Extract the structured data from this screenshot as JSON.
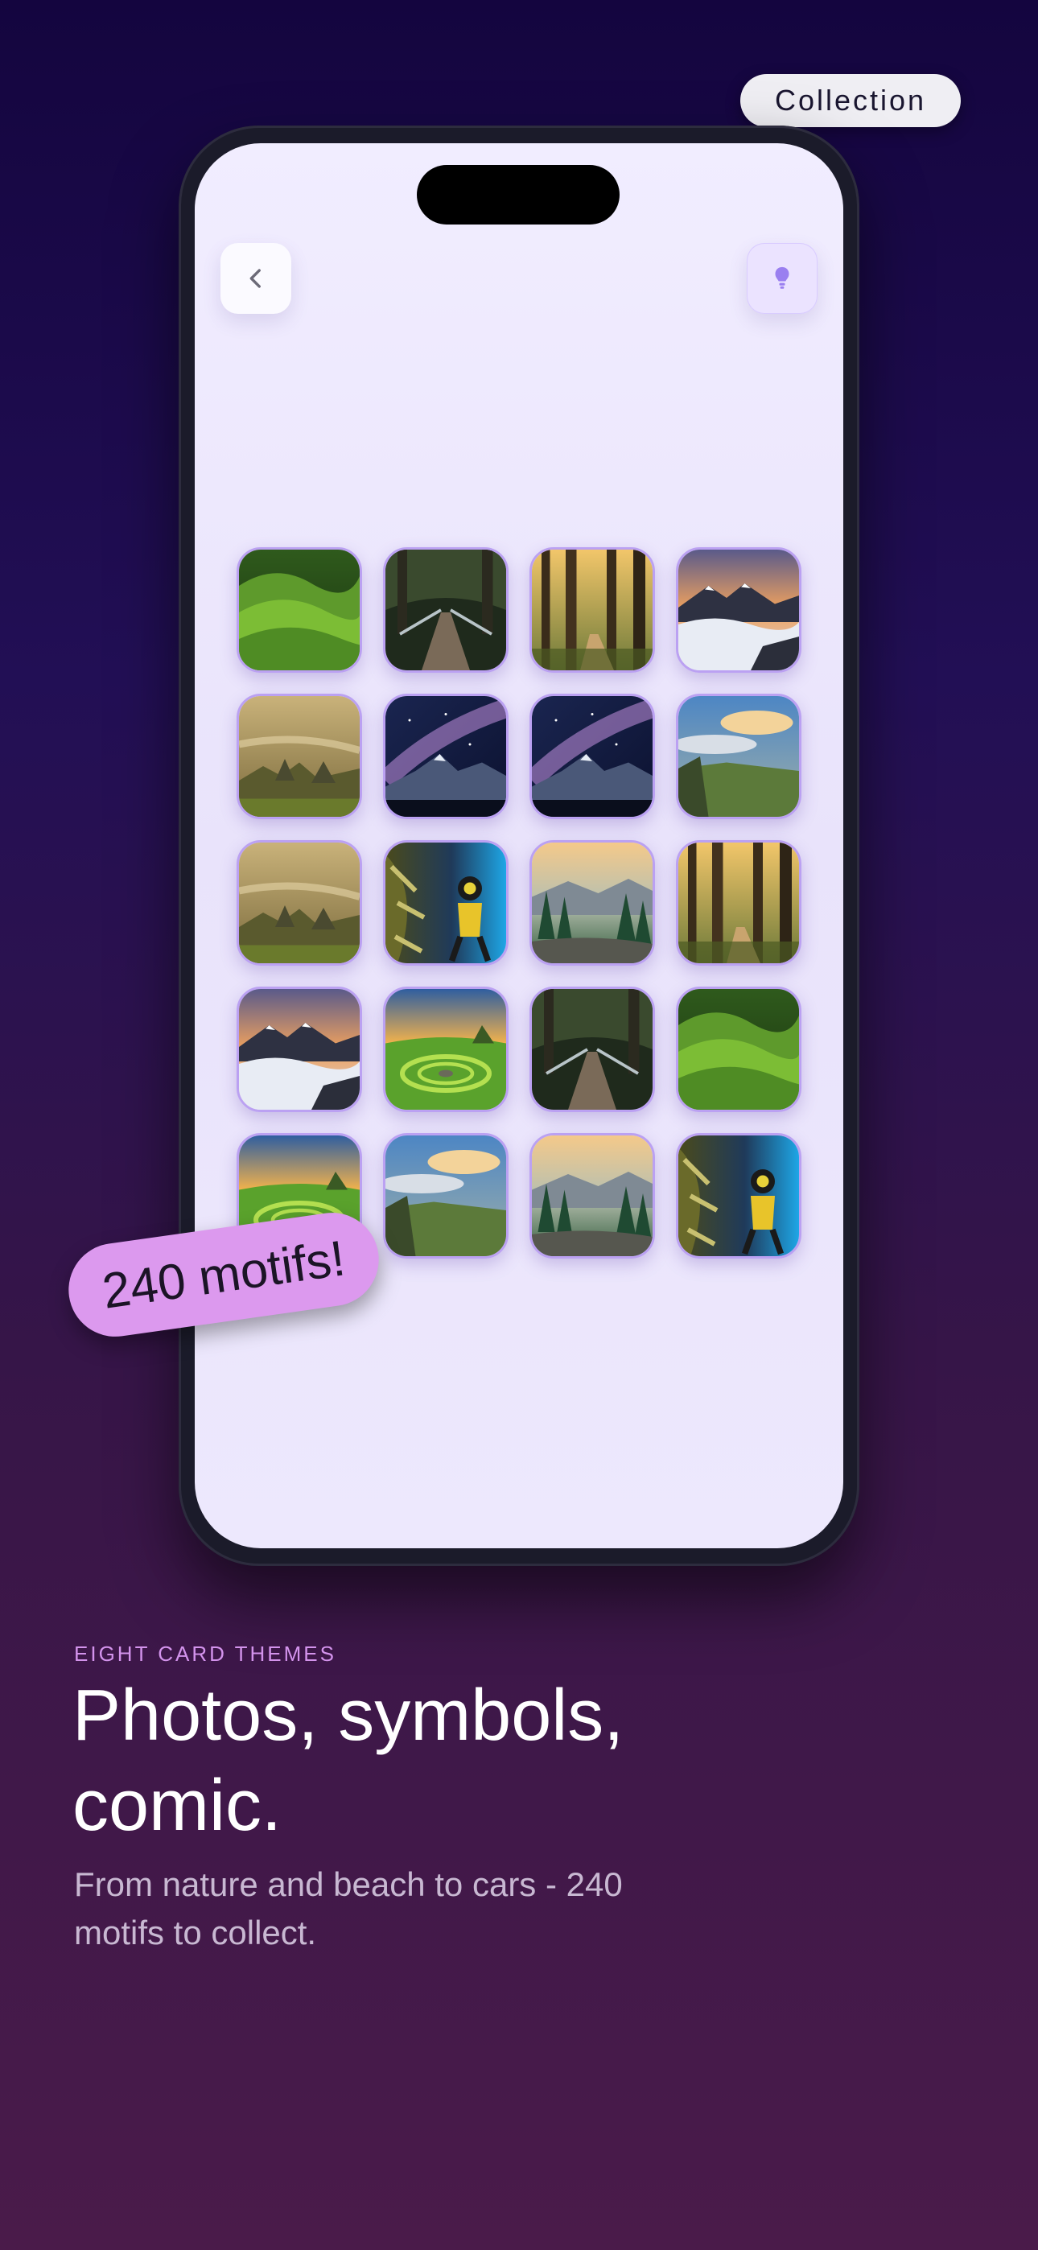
{
  "top_chip": {
    "label": "Collection"
  },
  "phone": {
    "back_icon": "chevron-left-icon",
    "hint_icon": "lightbulb-icon",
    "grid": [
      {
        "motif": "green-hills"
      },
      {
        "motif": "forest-bridge"
      },
      {
        "motif": "forest-path"
      },
      {
        "motif": "mountain-sea-of-clouds"
      },
      {
        "motif": "misty-valley"
      },
      {
        "motif": "milky-way-mountain"
      },
      {
        "motif": "milky-way-mountain"
      },
      {
        "motif": "cloudy-cliffs"
      },
      {
        "motif": "misty-valley"
      },
      {
        "motif": "underwater-diver"
      },
      {
        "motif": "pine-valley-sunset"
      },
      {
        "motif": "forest-path"
      },
      {
        "motif": "mountain-sea-of-clouds"
      },
      {
        "motif": "stone-circle-sunset"
      },
      {
        "motif": "forest-bridge"
      },
      {
        "motif": "green-hills"
      },
      {
        "motif": "stone-circle-sunset"
      },
      {
        "motif": "cloudy-cliffs"
      },
      {
        "motif": "pine-valley-sunset"
      },
      {
        "motif": "underwater-diver"
      }
    ]
  },
  "sticker": {
    "label": "240 motifs!"
  },
  "section": {
    "eyebrow": "EIGHT CARD THEMES",
    "headline": "Photos, symbols, comic.",
    "subtitle": "From nature and beach to cars - 240 motifs to collect."
  },
  "colors": {
    "accent_purple": "#bba1f2",
    "sticker": "#dc99ee",
    "eyebrow": "#d393ec"
  }
}
